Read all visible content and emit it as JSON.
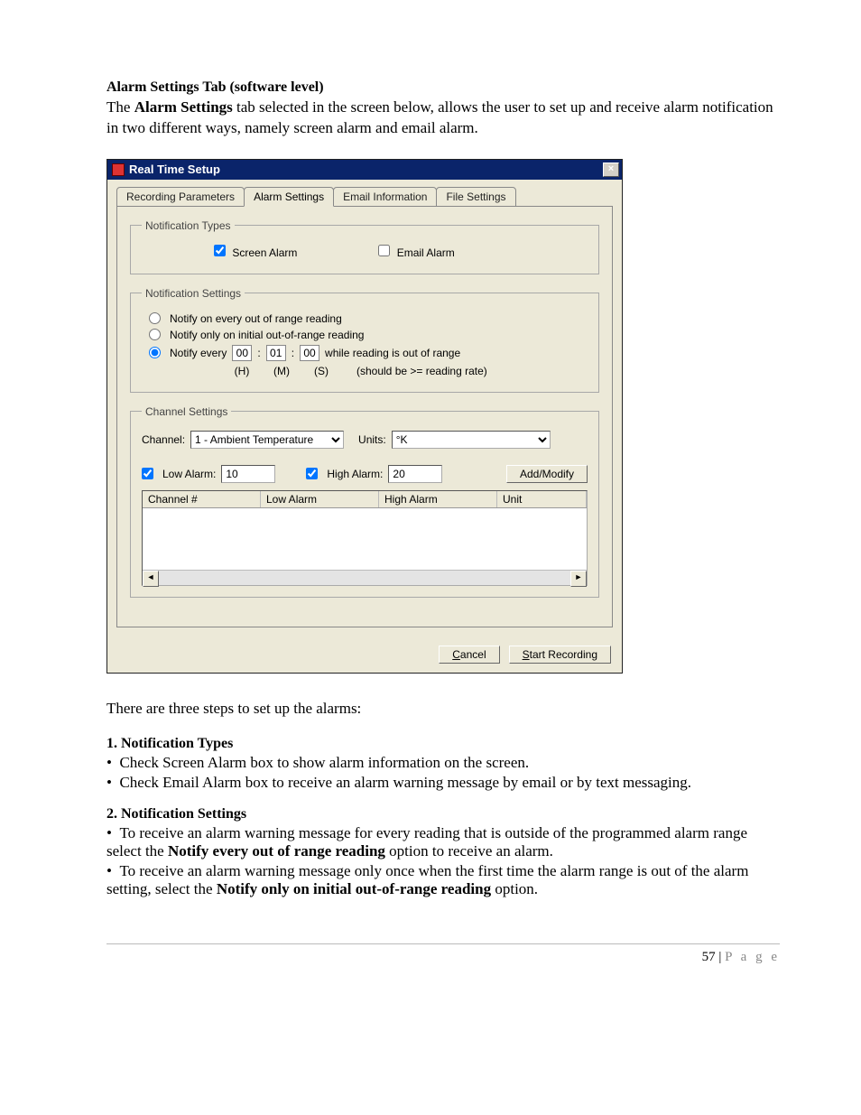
{
  "doc": {
    "heading": "Alarm Settings Tab (software level)",
    "intro_1": "The ",
    "intro_bold": "Alarm Settings",
    "intro_2": " tab selected in the screen below, allows the user to set up and receive alarm notification in two different ways, namely screen alarm and email alarm.",
    "after_dlg": "There are three steps to set up the alarms:",
    "step1_head": "1. Notification Types",
    "step1_b1": "Check Screen Alarm box to show alarm information on the screen.",
    "step1_b2": "Check Email Alarm box to receive an alarm warning message by email or by text messaging.",
    "step2_head": "2. Notification Settings",
    "step2_p1a": "To receive an alarm warning message for every reading that is outside of the programmed alarm range select the ",
    "step2_p1b": "Notify every out of range reading",
    "step2_p1c": " option to receive an alarm.",
    "step2_p2a": "To receive an alarm warning message only once when the first time the alarm range is out of the alarm setting, select the ",
    "step2_p2b": "Notify only on initial out-of-range reading",
    "step2_p2c": " option.",
    "page_num": "57",
    "page_word_sep": " | ",
    "page_word": "P a g e"
  },
  "dlg": {
    "title": "Real Time Setup",
    "tabs": {
      "recording": "Recording Parameters",
      "alarm": "Alarm Settings",
      "email": "Email Information",
      "file": "File Settings"
    },
    "notif_types": {
      "legend": "Notification Types",
      "screen": "Screen Alarm",
      "email": "Email Alarm"
    },
    "notif_settings": {
      "legend": "Notification Settings",
      "r1": "Notify on every out of range reading",
      "r2": "Notify only on initial out-of-range reading",
      "r3_pre": "Notify every",
      "r3_post": "while reading is out of range",
      "h": "00",
      "m": "01",
      "s": "00",
      "lbl_h": "(H)",
      "lbl_m": "(M)",
      "lbl_s": "(S)",
      "hint": "(should be >= reading rate)"
    },
    "channel": {
      "legend": "Channel Settings",
      "channel_lbl": "Channel:",
      "channel_val": "1 - Ambient Temperature",
      "units_lbl": "Units:",
      "units_val": "°K",
      "low_lbl": "Low Alarm:",
      "low_val": "10",
      "high_lbl": "High Alarm:",
      "high_val": "20",
      "addmod": "Add/Modify",
      "cols": {
        "c1": "Channel #",
        "c2": "Low Alarm",
        "c3": "High Alarm",
        "c4": "Unit"
      }
    },
    "buttons": {
      "cancel_u": "C",
      "cancel_rest": "ancel",
      "start_u": "S",
      "start_rest": "tart Recording"
    }
  }
}
